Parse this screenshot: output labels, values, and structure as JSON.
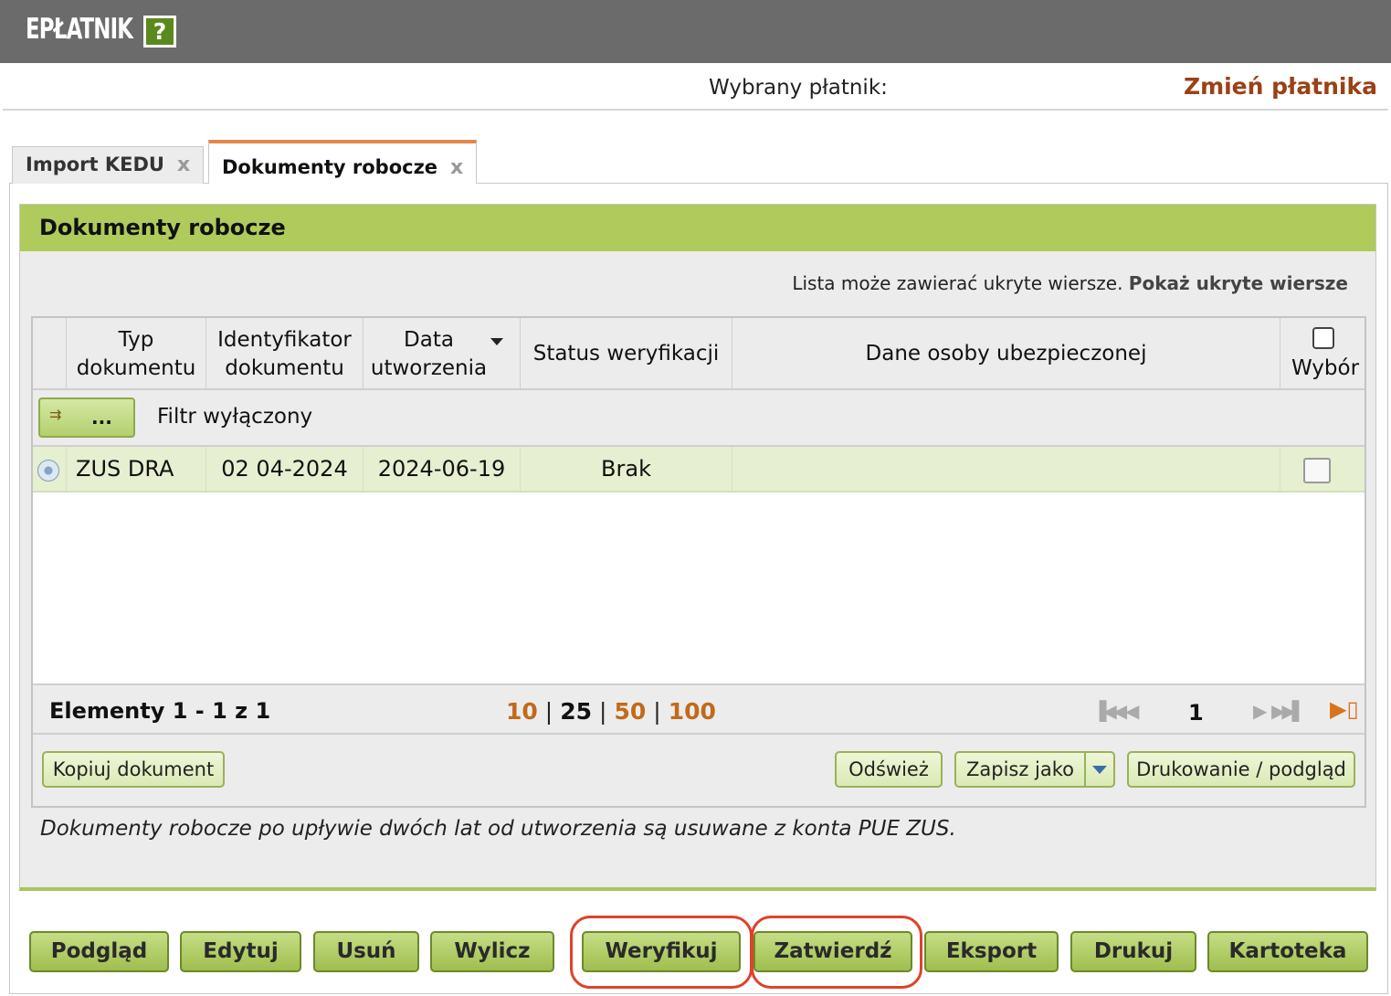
{
  "app": {
    "title": "EPŁATNIK",
    "help_icon": "?"
  },
  "payer": {
    "label": "Wybrany płatnik:",
    "change_link": "Zmień płatnika"
  },
  "tabs": [
    {
      "label": "Import KEDU",
      "close": "x"
    },
    {
      "label": "Dokumenty robocze",
      "close": "x"
    }
  ],
  "panel": {
    "title": "Dokumenty robocze",
    "hidden_note": "Lista może zawierać ukryte wiersze.",
    "hidden_link": "Pokaż ukryte wiersze"
  },
  "grid": {
    "columns": [
      "Typ dokumentu",
      "Identyfikator dokumentu",
      "Data utworzenia",
      "Status weryfikacji",
      "Dane osoby ubezpieczonej",
      "Wybór"
    ],
    "filter": {
      "button": "...",
      "status": "Filtr wyłączony"
    },
    "rows": [
      {
        "type": "ZUS DRA",
        "id": "02 04-2024",
        "date": "2024-06-19",
        "status": "Brak",
        "insured": ""
      }
    ],
    "pager": {
      "elements": "Elementy 1 - 1 z 1",
      "sizes": [
        "10",
        "25",
        "50",
        "100"
      ],
      "current_size": "25",
      "page": "1"
    },
    "actions": {
      "copy": "Kopiuj dokument",
      "refresh": "Odśwież",
      "save_as": "Zapisz jako",
      "print": "Drukowanie / podgląd"
    }
  },
  "footnote": "Dokumenty robocze po upływie dwóch lat od utworzenia są usuwane z konta PUE ZUS.",
  "buttons": {
    "preview": "Podgląd",
    "edit": "Edytuj",
    "delete": "Usuń",
    "calculate": "Wylicz",
    "verify": "Weryfikuj",
    "approve": "Zatwierdź",
    "export": "Eksport",
    "print": "Drukuj",
    "card": "Kartoteka"
  },
  "colors": {
    "accent_green": "#aecb5c",
    "highlight_red": "#e0412a",
    "link_orange": "#c2691a",
    "link_brown": "#9a4116"
  }
}
